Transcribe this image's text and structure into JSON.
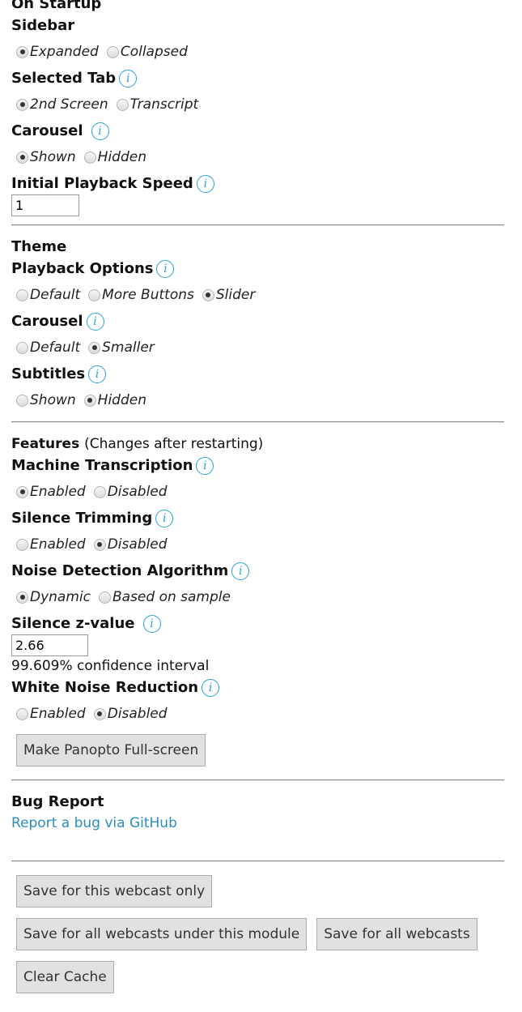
{
  "startup": {
    "heading": "On Startup",
    "sidebar": {
      "label": "Sidebar",
      "options": [
        "Expanded",
        "Collapsed"
      ]
    },
    "selected_tab": {
      "label": "Selected Tab",
      "options": [
        "2nd Screen",
        "Transcript"
      ]
    },
    "carousel": {
      "label": "Carousel",
      "options": [
        "Shown",
        "Hidden"
      ]
    },
    "playback_speed": {
      "label": "Initial Playback Speed",
      "value": "1"
    }
  },
  "theme": {
    "heading": "Theme",
    "playback_options": {
      "label": "Playback Options",
      "options": [
        "Default",
        "More Buttons",
        "Slider"
      ]
    },
    "carousel": {
      "label": "Carousel",
      "options": [
        "Default",
        "Smaller"
      ]
    },
    "subtitles": {
      "label": "Subtitles",
      "options": [
        "Shown",
        "Hidden"
      ]
    }
  },
  "features": {
    "heading": "Features",
    "note": "(Changes after restarting)",
    "machine_transcription": {
      "label": "Machine Transcription",
      "options": [
        "Enabled",
        "Disabled"
      ]
    },
    "silence_trimming": {
      "label": "Silence Trimming",
      "options": [
        "Enabled",
        "Disabled"
      ]
    },
    "noise_detection": {
      "label": "Noise Detection Algorithm",
      "options": [
        "Dynamic",
        "Based on sample"
      ]
    },
    "silence_z": {
      "label": "Silence z-value",
      "value": "2.66",
      "confidence": "99.609% confidence interval"
    },
    "white_noise": {
      "label": "White Noise Reduction",
      "options": [
        "Enabled",
        "Disabled"
      ]
    },
    "fullscreen_button": "Make Panopto Full-screen"
  },
  "bug_report": {
    "heading": "Bug Report",
    "link": "Report a bug via GitHub"
  },
  "actions": {
    "save_webcast": "Save for this webcast only",
    "save_module": "Save for all webcasts under this module",
    "save_all": "Save for all webcasts",
    "clear_cache": "Clear Cache"
  },
  "info_icon": "info-icon",
  "colors": {
    "link": "#2a8fc1",
    "info": "#29a3dc",
    "button_bg": "#e1e1e1"
  }
}
